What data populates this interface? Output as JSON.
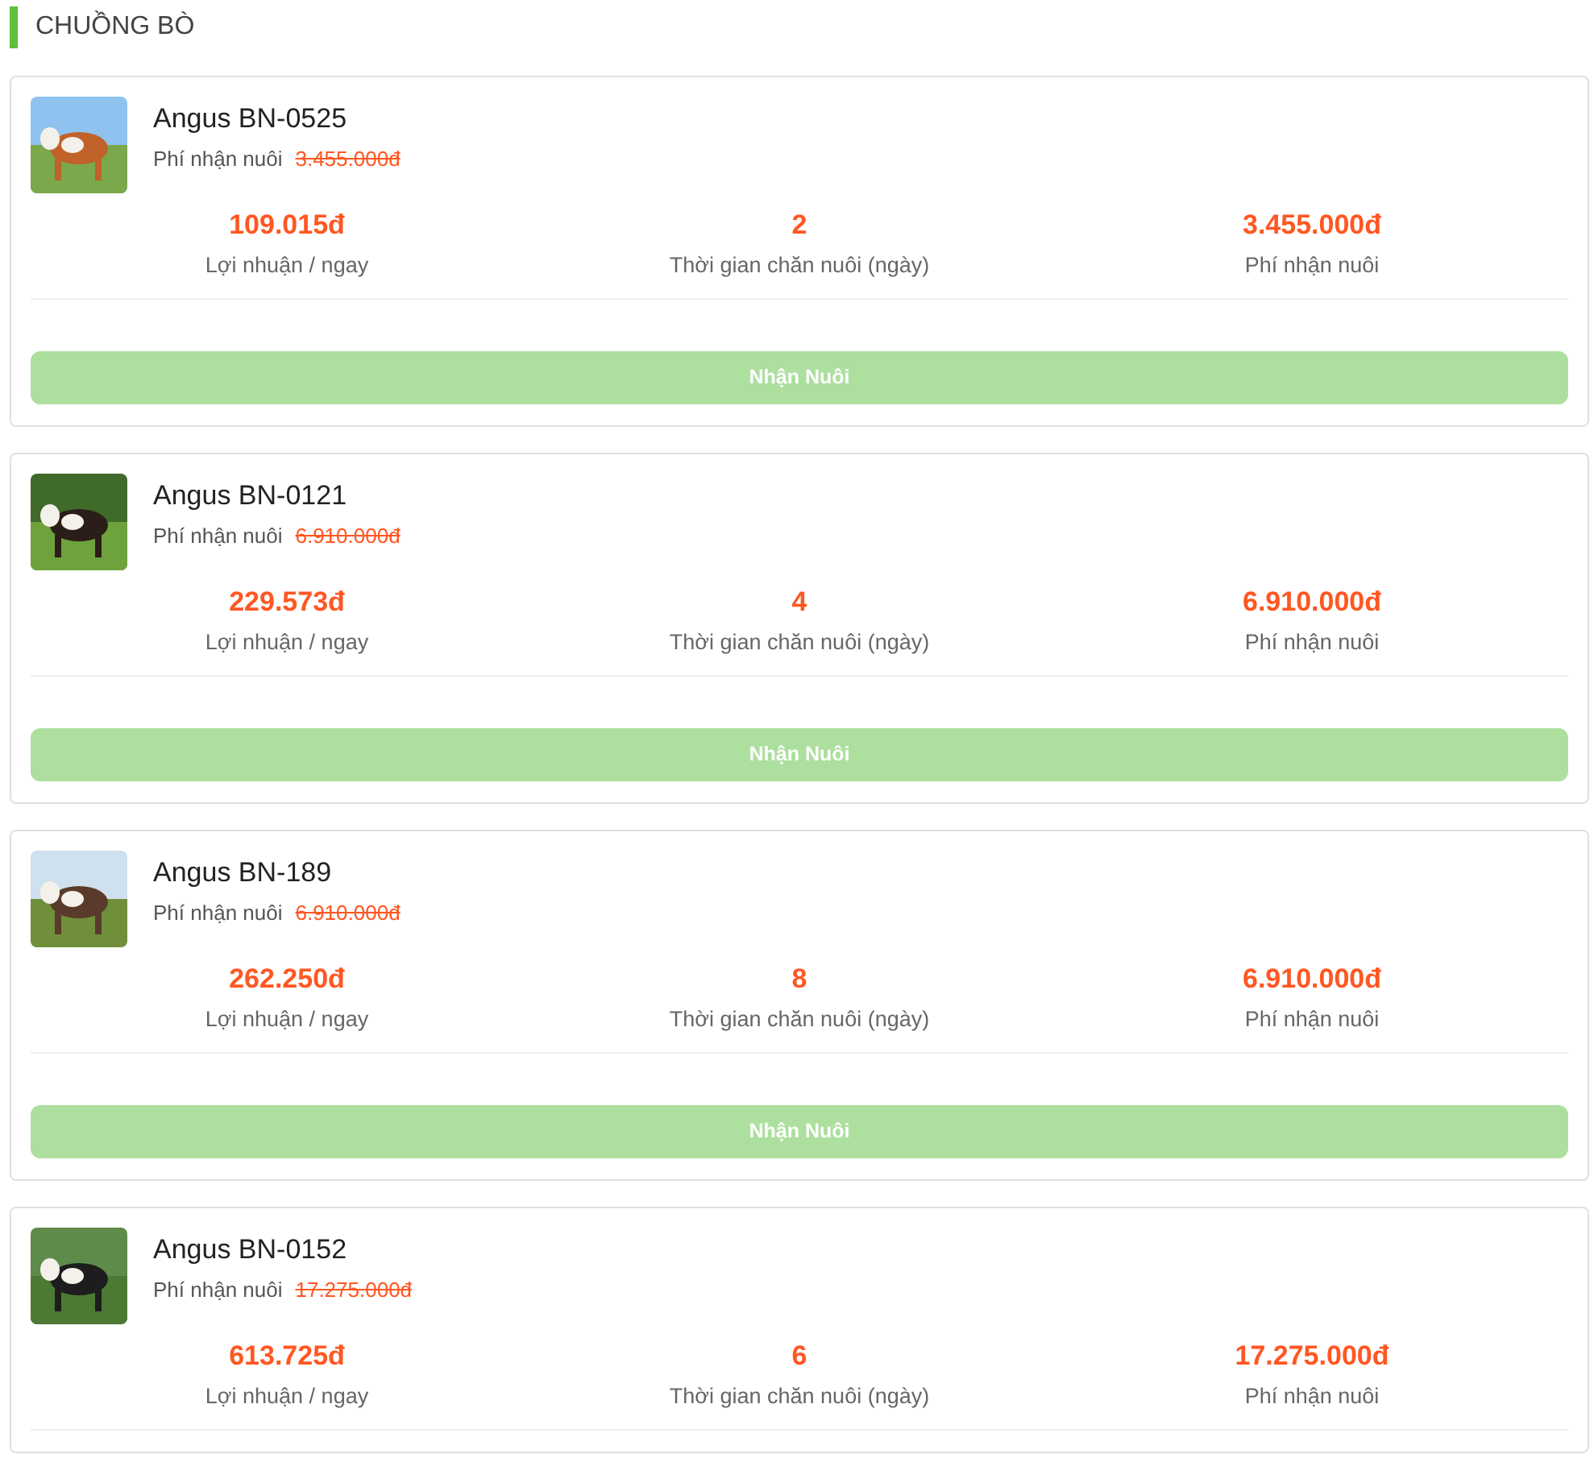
{
  "section_title": "CHUỒNG BÒ",
  "cards": [
    {
      "name": "Angus BN-0525",
      "fee_label": "Phí nhận nuôi",
      "old_fee": "3.455.000đ",
      "picture": {
        "kind": "picture"
      },
      "stats": [
        {
          "value": "109.015đ",
          "label": "Lợi nhuận / ngay"
        },
        {
          "value": "2",
          "label": "Thời gian chăn nuôi (ngày)"
        },
        {
          "value": "3.455.000đ",
          "label": "Phí nhận nuôi"
        }
      ],
      "button": {
        "label": "Nhận Nuôi",
        "disabled": true
      }
    },
    {
      "name": "Angus BN-0121",
      "fee_label": "Phí nhận nuôi",
      "old_fee": "6.910.000đ",
      "picture": {
        "kind": "picture"
      },
      "stats": [
        {
          "value": "229.573đ",
          "label": "Lợi nhuận / ngay"
        },
        {
          "value": "4",
          "label": "Thời gian chăn nuôi (ngày)"
        },
        {
          "value": "6.910.000đ",
          "label": "Phí nhận nuôi"
        }
      ],
      "button": {
        "label": "Nhận Nuôi",
        "disabled": true
      }
    },
    {
      "name": "Angus BN-189",
      "fee_label": "Phí nhận nuôi",
      "old_fee": "6.910.000đ",
      "picture": {
        "kind": "picture"
      },
      "stats": [
        {
          "value": "262.250đ",
          "label": "Lợi nhuận / ngay"
        },
        {
          "value": "8",
          "label": "Thời gian chăn nuôi (ngày)"
        },
        {
          "value": "6.910.000đ",
          "label": "Phí nhận nuôi"
        }
      ],
      "button": {
        "label": "Nhận Nuôi",
        "disabled": true
      }
    },
    {
      "name": "Angus BN-0152",
      "fee_label": "Phí nhận nuôi",
      "old_fee": "17.275.000đ",
      "picture": {
        "kind": "picture"
      },
      "stats": [
        {
          "value": "613.725đ",
          "label": "Lợi nhuận / ngay"
        },
        {
          "value": "6",
          "label": "Thời gian chăn nuôi (ngày)"
        },
        {
          "value": "17.275.000đ",
          "label": "Phí nhận nuôi"
        }
      ]
    }
  ]
}
